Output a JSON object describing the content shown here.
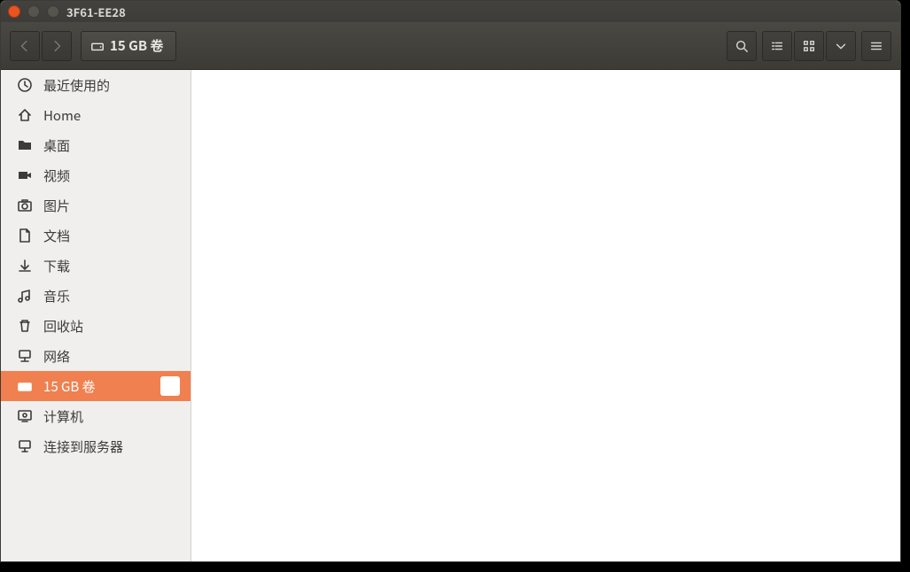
{
  "titlebar": {
    "title": "3F61-EE28"
  },
  "breadcrumb": {
    "current": "15 GB 卷"
  },
  "sidebar": {
    "items": [
      {
        "id": "recent",
        "icon": "clock",
        "label": "最近使用的"
      },
      {
        "id": "home",
        "icon": "home",
        "label": "Home"
      },
      {
        "id": "desktop",
        "icon": "folder",
        "label": "桌面"
      },
      {
        "id": "videos",
        "icon": "video",
        "label": "视频"
      },
      {
        "id": "pictures",
        "icon": "camera",
        "label": "图片"
      },
      {
        "id": "documents",
        "icon": "document",
        "label": "文档"
      },
      {
        "id": "downloads",
        "icon": "download",
        "label": "下载"
      },
      {
        "id": "music",
        "icon": "music",
        "label": "音乐"
      },
      {
        "id": "trash",
        "icon": "trash",
        "label": "回收站"
      },
      {
        "id": "network",
        "icon": "network",
        "label": "网络"
      },
      {
        "id": "volume",
        "icon": "drive",
        "label": "15 GB 卷",
        "selected": true,
        "ejectable": true
      },
      {
        "id": "computer",
        "icon": "computer",
        "label": "计算机"
      },
      {
        "id": "connect",
        "icon": "connect",
        "label": "连接到服务器"
      }
    ]
  }
}
